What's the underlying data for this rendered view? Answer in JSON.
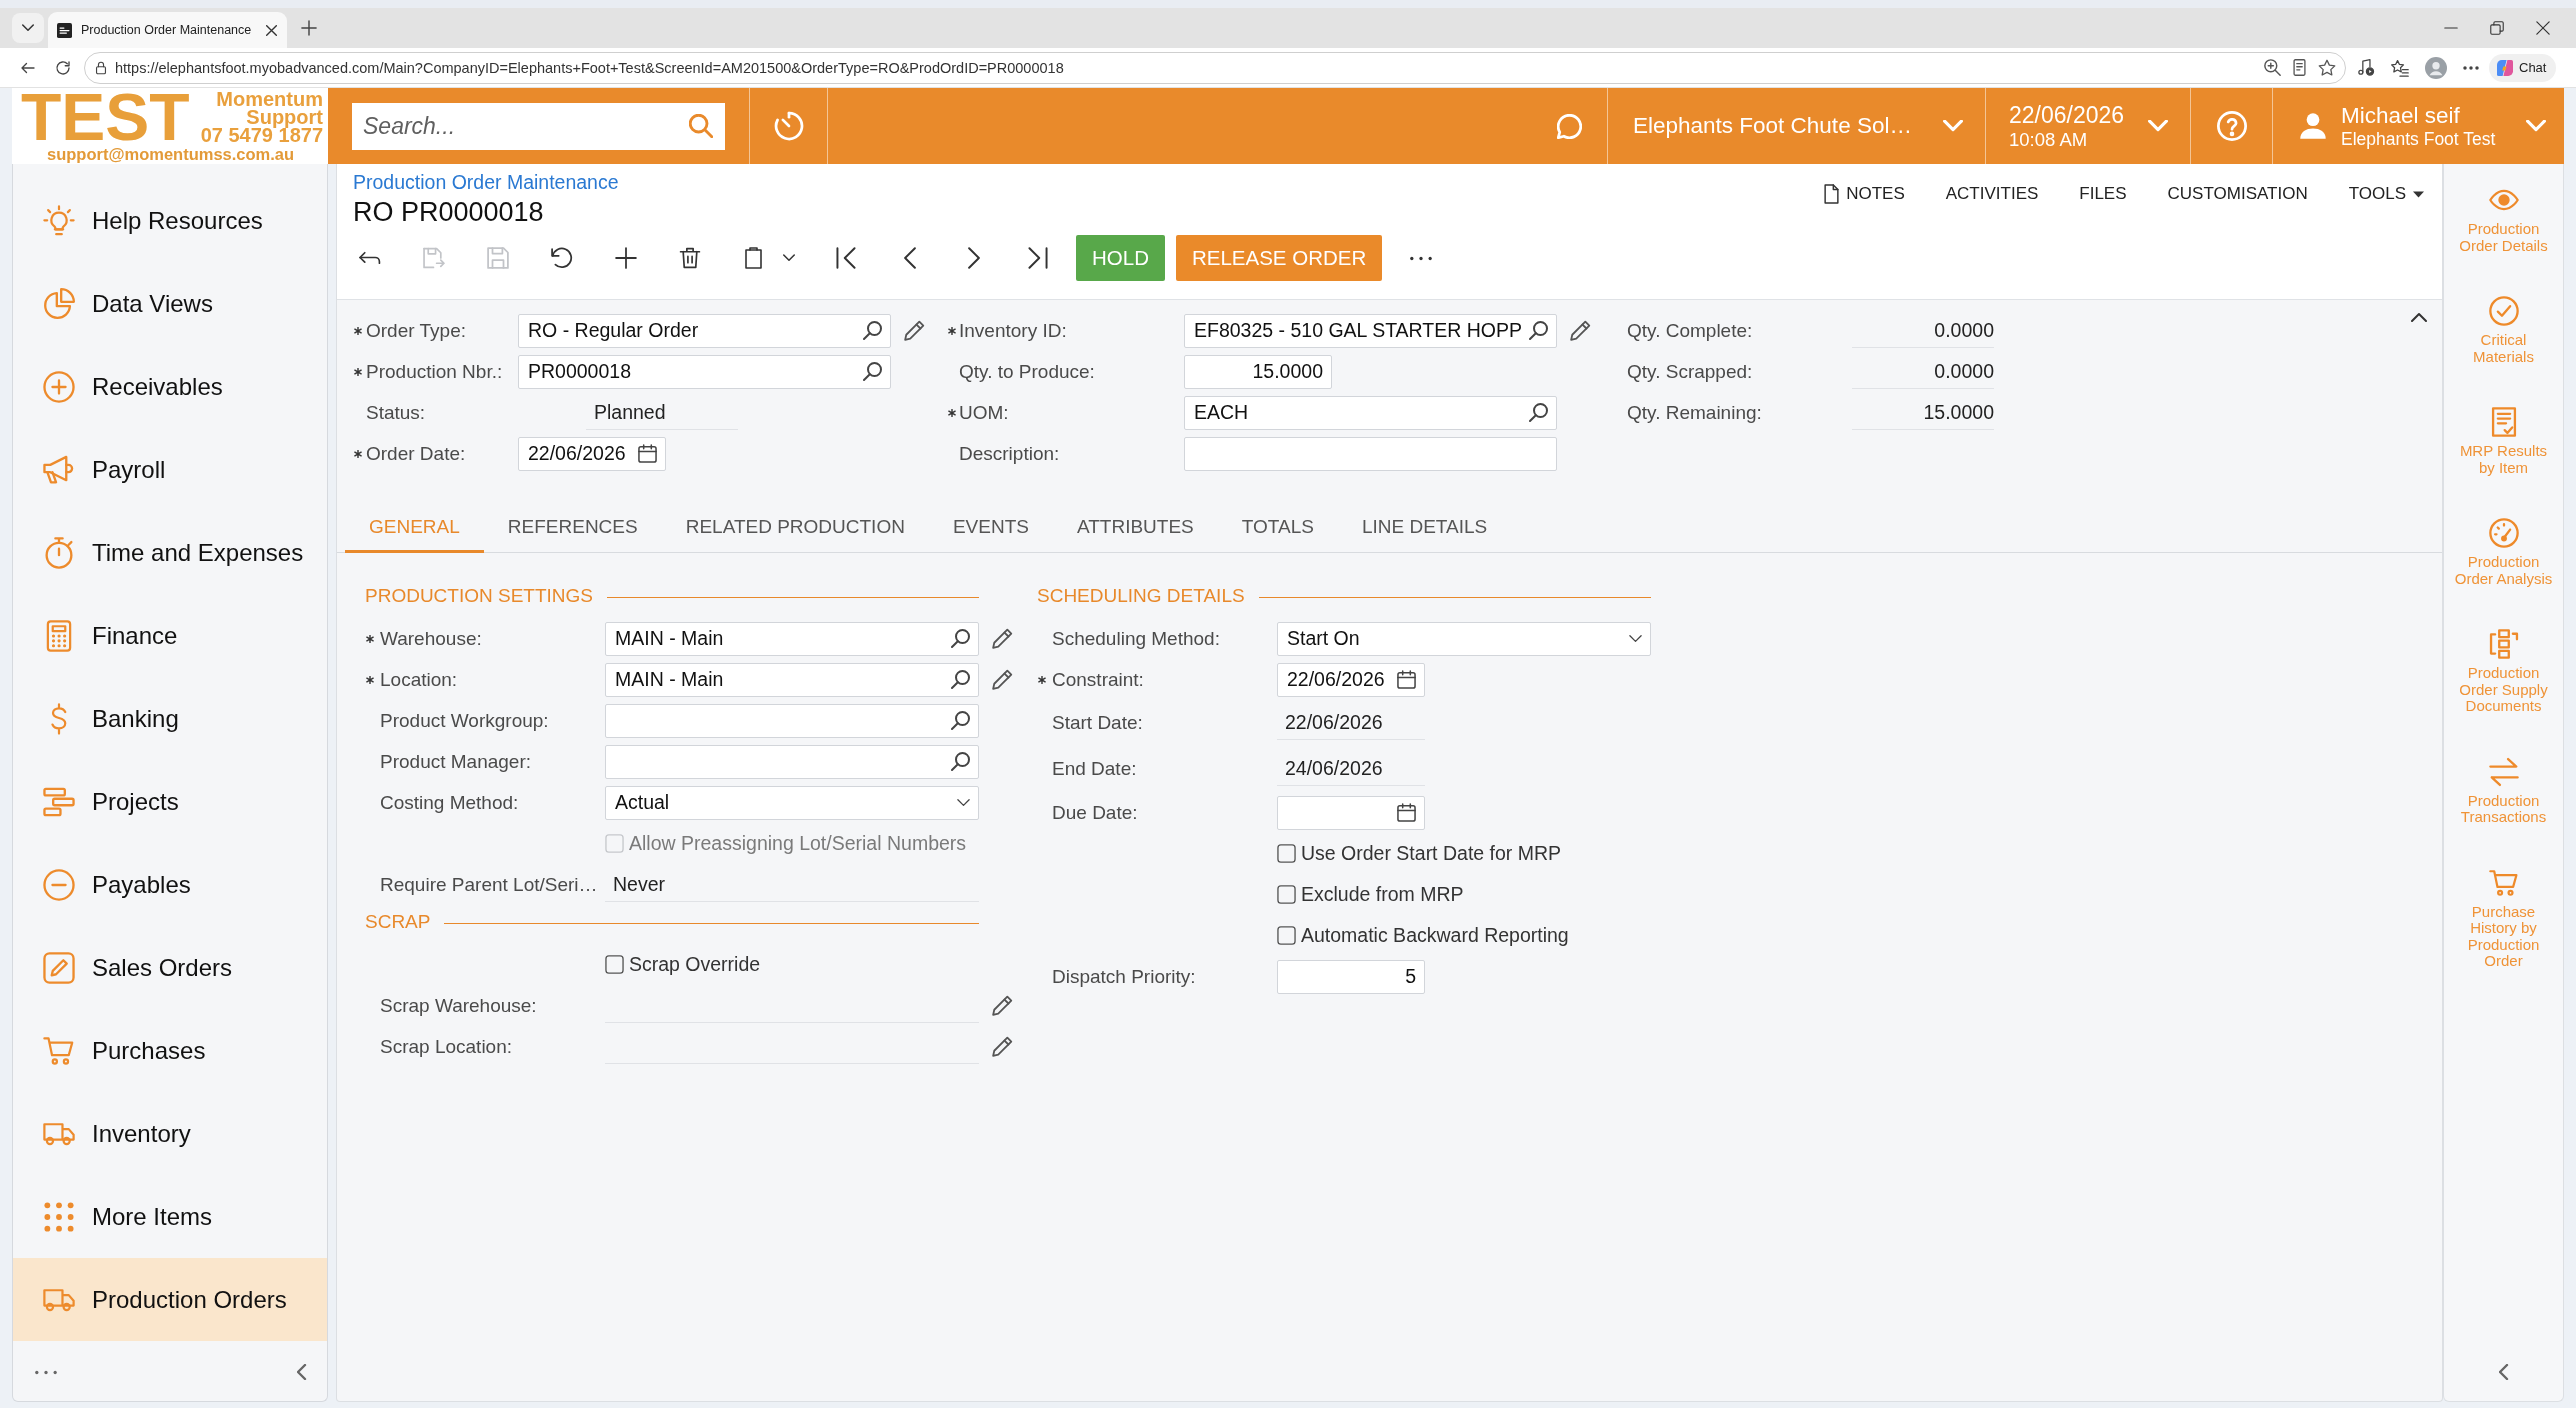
{
  "browser": {
    "tab_title": "Production Order Maintenance",
    "url": "https://elephantsfoot.myobadvanced.com/Main?CompanyID=Elephants+Foot+Test&ScreenId=AM201500&OrderType=RO&ProdOrdID=PR0000018",
    "chat_label": "Chat"
  },
  "logo": {
    "mark": "TEST",
    "lines": [
      "Momentum",
      "Support",
      "07 5479 1877"
    ],
    "email": "support@momentumss.com.au"
  },
  "header": {
    "search": {
      "placeholder": "Search..."
    },
    "company": "Elephants Foot Chute Sol…",
    "date": "22/06/2026",
    "time": "10:08 AM",
    "user": {
      "name": "Michael seif",
      "tenant": "Elephants Foot Test"
    }
  },
  "sidebar": {
    "items": [
      {
        "label": "Help Resources",
        "selected": false
      },
      {
        "label": "Data Views",
        "selected": false
      },
      {
        "label": "Receivables",
        "selected": false
      },
      {
        "label": "Payroll",
        "selected": false
      },
      {
        "label": "Time and Expenses",
        "selected": false
      },
      {
        "label": "Finance",
        "selected": false
      },
      {
        "label": "Banking",
        "selected": false
      },
      {
        "label": "Projects",
        "selected": false
      },
      {
        "label": "Payables",
        "selected": false
      },
      {
        "label": "Sales Orders",
        "selected": false
      },
      {
        "label": "Purchases",
        "selected": false
      },
      {
        "label": "Inventory",
        "selected": false
      },
      {
        "label": "More Items",
        "selected": false
      },
      {
        "label": "Production Orders",
        "selected": true
      }
    ]
  },
  "page": {
    "breadcrumb": "Production Order Maintenance",
    "title": "RO PR0000018",
    "links": [
      {
        "label": "NOTES",
        "kind": "note"
      },
      {
        "label": "ACTIVITIES",
        "kind": "plain"
      },
      {
        "label": "FILES",
        "kind": "plain"
      },
      {
        "label": "CUSTOMISATION",
        "kind": "plain"
      },
      {
        "label": "TOOLS",
        "kind": "menu"
      }
    ]
  },
  "toolbar": {
    "tools": [
      {
        "disabled": false
      },
      {
        "disabled": true
      },
      {
        "disabled": true
      },
      {
        "disabled": false
      },
      {
        "disabled": false
      },
      {
        "disabled": false
      },
      {
        "disabled": false
      },
      {
        "disabled": false
      },
      {
        "disabled": false
      },
      {
        "disabled": false
      },
      {
        "disabled": false
      }
    ],
    "actions": [
      {
        "label": "HOLD",
        "kind": "success"
      },
      {
        "label": "RELEASE ORDER",
        "kind": "primary"
      }
    ]
  },
  "summary": {
    "columns": [
      [
        {
          "kind": "lookup",
          "label": "Order Type:",
          "required": true,
          "value": "RO - Regular Order",
          "edit": true
        },
        {
          "kind": "lookup",
          "label": "Production Nbr.:",
          "required": true,
          "value": "PR0000018",
          "edit": false
        },
        {
          "kind": "readonly",
          "label": "Status:",
          "required": false,
          "value": "Planned",
          "edit": false
        },
        {
          "kind": "date",
          "label": "Order Date:",
          "required": true,
          "value": "22/06/2026",
          "edit": false
        }
      ],
      [
        {
          "kind": "lookup",
          "label": "Inventory ID:",
          "required": true,
          "value": "EF80325 - 510 GAL STARTER HOPP",
          "edit": true
        },
        {
          "kind": "number",
          "label": "Qty. to Produce:",
          "required": false,
          "value": "15.0000",
          "edit": false
        },
        {
          "kind": "lookup",
          "label": "UOM:",
          "required": true,
          "value": "EACH",
          "edit": false
        },
        {
          "kind": "text",
          "label": "Description:",
          "required": false,
          "edit": false
        }
      ],
      [
        {
          "kind": "amount",
          "label": "Qty. Complete:",
          "required": false,
          "value": "0.0000",
          "edit": false
        },
        {
          "kind": "amount",
          "label": "Qty. Scrapped:",
          "required": false,
          "value": "0.0000",
          "edit": false
        },
        {
          "kind": "amount",
          "label": "Qty. Remaining:",
          "required": false,
          "value": "15.0000",
          "edit": false
        }
      ]
    ]
  },
  "tabs": [
    {
      "label": "GENERAL",
      "selected": true
    },
    {
      "label": "REFERENCES",
      "selected": false
    },
    {
      "label": "RELATED PRODUCTION",
      "selected": false
    },
    {
      "label": "EVENTS",
      "selected": false
    },
    {
      "label": "ATTRIBUTES",
      "selected": false
    },
    {
      "label": "TOTALS",
      "selected": false
    },
    {
      "label": "LINE DETAILS",
      "selected": false
    }
  ],
  "general": {
    "columns": [
      [
        {
          "title": "PRODUCTION SETTINGS",
          "fields": [
            {
              "kind": "lookup",
              "label": "Warehouse:",
              "required": true,
              "value": "MAIN - Main",
              "edit": true
            },
            {
              "kind": "lookup",
              "label": "Location:",
              "required": true,
              "value": "MAIN - Main",
              "edit": true
            },
            {
              "kind": "lookup",
              "label": "Product Workgroup:",
              "required": false,
              "edit": false
            },
            {
              "kind": "lookup",
              "label": "Product Manager:",
              "required": false,
              "edit": false
            },
            {
              "kind": "select",
              "label": "Costing Method:",
              "required": false,
              "value": "Actual",
              "edit": false
            },
            {
              "kind": "checkbox",
              "label": "Allow Preassigning Lot/Serial Numbers",
              "required": false,
              "checked": false,
              "disabled": true,
              "edit": false
            },
            {
              "kind": "readonly",
              "label": "Require Parent Lot/Seri…",
              "required": false,
              "value": "Never",
              "edit": false
            }
          ]
        },
        {
          "title": "SCRAP",
          "fields": [
            {
              "kind": "checkbox",
              "label": "Scrap Override",
              "required": false,
              "checked": false,
              "disabled": false,
              "edit": false
            },
            {
              "kind": "readonly",
              "label": "Scrap Warehouse:",
              "required": false,
              "edit": true
            },
            {
              "kind": "readonly",
              "label": "Scrap Location:",
              "required": false,
              "edit": true
            }
          ]
        }
      ],
      [
        {
          "title": "SCHEDULING DETAILS",
          "fields": [
            {
              "kind": "select",
              "label": "Scheduling Method:",
              "required": false,
              "value": "Start On",
              "edit": false
            },
            {
              "kind": "date",
              "label": "Constraint:",
              "required": true,
              "value": "22/06/2026",
              "edit": false
            },
            {
              "kind": "readonly",
              "label": "Start Date:",
              "required": false,
              "value": "22/06/2026",
              "edit": false
            },
            {
              "kind": "readonly",
              "label": "End Date:",
              "required": false,
              "value": "24/06/2026",
              "edit": false
            },
            {
              "kind": "date",
              "label": "Due Date:",
              "required": false,
              "edit": false
            },
            {
              "kind": "checkbox",
              "label": "Use Order Start Date for MRP",
              "required": false,
              "checked": false,
              "disabled": false,
              "edit": false
            },
            {
              "kind": "checkbox",
              "label": "Exclude from MRP",
              "required": false,
              "checked": false,
              "disabled": false,
              "edit": false
            },
            {
              "kind": "checkbox",
              "label": "Automatic Backward Reporting",
              "required": false,
              "checked": false,
              "disabled": false,
              "edit": false
            },
            {
              "kind": "number",
              "label": "Dispatch Priority:",
              "required": false,
              "value": "5",
              "edit": false
            }
          ]
        }
      ]
    ]
  },
  "side_panel": {
    "items": [
      "Production Order Details",
      "Critical Materials",
      "MRP Results by Item",
      "Production Order Analysis",
      "Production Order Supply Documents",
      "Production Transactions",
      "Purchase History by Production Order"
    ]
  }
}
